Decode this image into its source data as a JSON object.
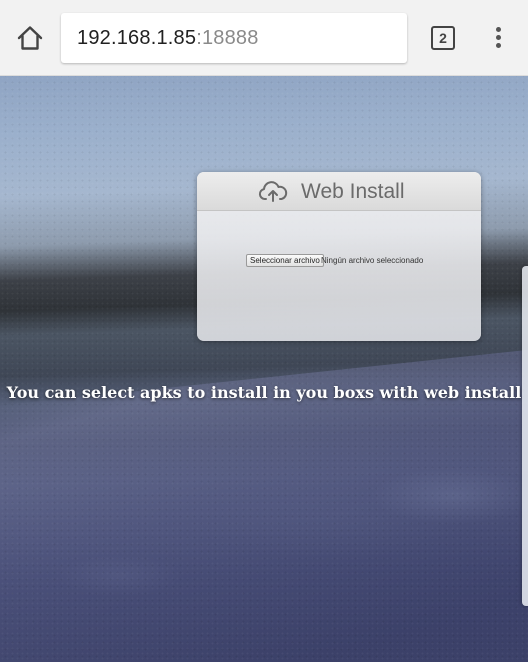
{
  "browser": {
    "url_host": "192.168.1.85",
    "url_port": ":18888",
    "tab_count": "2",
    "icons": {
      "home": "home-icon",
      "menu": "more-vertical-icon"
    }
  },
  "card": {
    "title": "Web Install",
    "icon": "cloud-upload-icon",
    "file_button_label": "Seleccionar archivo",
    "file_status": "Ningún archivo seleccionado"
  },
  "caption": "You can select apks to install in you boxs with web install"
}
